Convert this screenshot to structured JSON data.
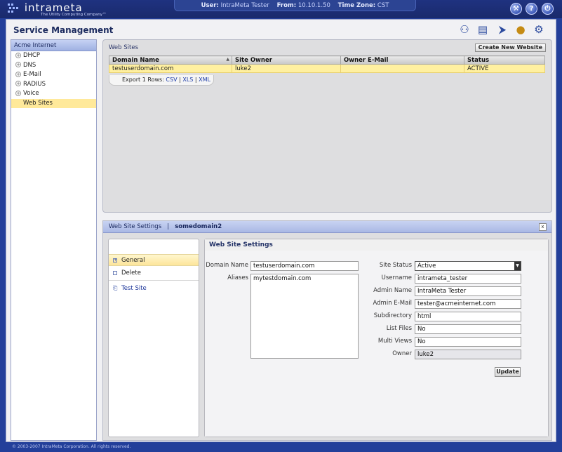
{
  "app": {
    "logo_text": "intrameta",
    "logo_tagline": "The Utility Computing Company™"
  },
  "session": {
    "user_label": "User:",
    "user_value": "IntraMeta Tester",
    "from_label": "From:",
    "from_value": "10.10.1.50",
    "tz_label": "Time Zone:",
    "tz_value": "CST"
  },
  "top_icons": [
    "wrench-icon",
    "help-icon",
    "power-icon"
  ],
  "page": {
    "title": "Service Management"
  },
  "toolbar_icons": [
    "users-icon",
    "id-card-icon",
    "network-icon",
    "globe-icon",
    "gears-icon"
  ],
  "tree": {
    "header": "Acme Internet",
    "items": [
      {
        "label": "DHCP",
        "expandable": true
      },
      {
        "label": "DNS",
        "expandable": true
      },
      {
        "label": "E-Mail",
        "expandable": true
      },
      {
        "label": "RADIUS",
        "expandable": true
      },
      {
        "label": "Voice",
        "expandable": true
      },
      {
        "label": "Web Sites",
        "expandable": false,
        "selected": true
      }
    ]
  },
  "websites": {
    "panel_label": "Web Sites",
    "create_button": "Create New Website",
    "columns": [
      "Domain Name",
      "Site Owner",
      "Owner E-Mail",
      "Status"
    ],
    "rows": [
      [
        "testuserdomain.com",
        "luke2",
        "",
        "ACTIVE"
      ]
    ],
    "export_label": "Export 1 Rows:",
    "export_formats": [
      "CSV",
      "XLS",
      "XML"
    ],
    "export_sep": "|"
  },
  "settings": {
    "panel_title": "Web Site Settings",
    "separator": "|",
    "domain": "somedomain2",
    "close_label": "x",
    "nav": {
      "general": "General",
      "delete": "Delete",
      "test_site": "Test Site"
    },
    "form_title": "Web Site Settings",
    "fields": {
      "domain_name_label": "Domain Name",
      "domain_name_value": "testuserdomain.com",
      "aliases_label": "Aliases",
      "aliases_value": "mytestdomain.com",
      "site_status_label": "Site Status",
      "site_status_value": "Active",
      "username_label": "Username",
      "username_value": "intrameta_tester",
      "admin_name_label": "Admin Name",
      "admin_name_value": "IntraMeta Tester",
      "admin_email_label": "Admin E-Mail",
      "admin_email_value": "tester@acmeinternet.com",
      "subdirectory_label": "Subdirectory",
      "subdirectory_value": "html",
      "list_files_label": "List Files",
      "list_files_value": "No",
      "multi_views_label": "Multi Views",
      "multi_views_value": "No",
      "owner_label": "Owner",
      "owner_value": "luke2"
    },
    "update_button": "Update"
  },
  "footer": {
    "text": "© 2003-2007 IntraMeta Corporation.  All rights reserved."
  },
  "colors": {
    "background": "#233f9a",
    "selection": "#fff0a0",
    "panel_header": "#a9b8e4"
  }
}
